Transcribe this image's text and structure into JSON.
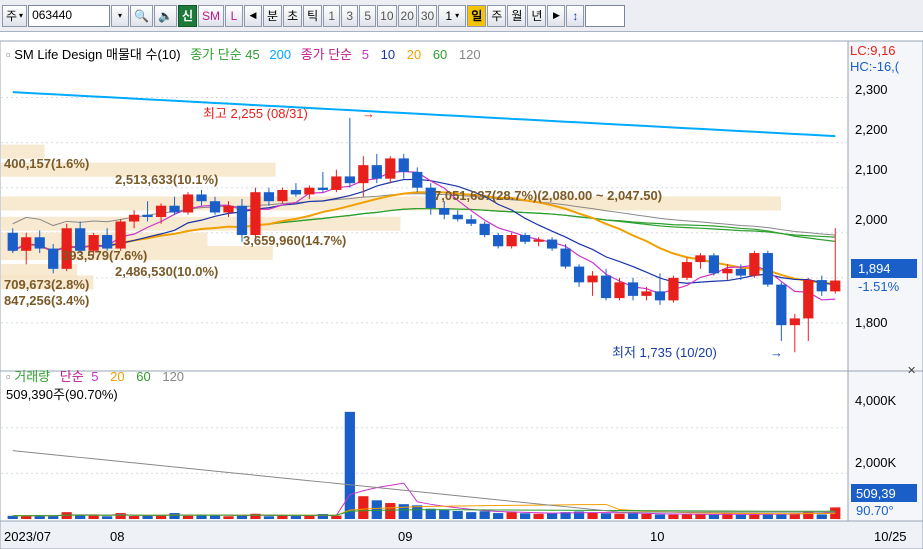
{
  "toolbar": {
    "period": "주",
    "code": "063440",
    "sin": "신",
    "sm": "SM",
    "l": "L",
    "bun": "분",
    "cho": "초",
    "tick": "틱",
    "nums": [
      "1",
      "3",
      "5",
      "10",
      "20",
      "30"
    ],
    "count": "1",
    "day": "일",
    "week": "주",
    "month": "월",
    "year": "년"
  },
  "price_panel": {
    "legend": {
      "title": "SM Life Design 매물대 수(10)",
      "ma_label1": "종가 단순 45",
      "ma_label1_extra": "200",
      "ma_label2": "종가 단순",
      "ma_periods": [
        "5",
        "10",
        "20",
        "60",
        "120"
      ]
    },
    "corner_lc": "LC:9,16",
    "corner_hc": "HC:-16,(",
    "y_ticks": [
      "2,300",
      "2,200",
      "2,100",
      "2,000",
      "1,800"
    ],
    "current_price": "1,894",
    "current_change": "-1.51%",
    "max_label": "최고 2,255 (08/31)",
    "min_label": "최저 1,735 (10/20)",
    "volume_profile": [
      "400,157(1.6%)",
      "2,513,633(10.1%)",
      "7,051,637(28.7%)(2,080.00 ~ 2,047.50)",
      "3,659,960(14.7%)",
      "393,579(7.6%)",
      "2,486,530(10.0%)",
      "709,673(2.8%)",
      "847,256(3.4%)"
    ]
  },
  "volume_panel": {
    "legend": {
      "title": "거래량",
      "ma_label": "단순",
      "periods": [
        "5",
        "20",
        "60",
        "120"
      ]
    },
    "last_vol": "509,390주(90.70%)",
    "y_ticks": [
      "4,000K",
      "2,000K"
    ],
    "current_vol": "509,39",
    "current_pct": "90.70°"
  },
  "x_labels": [
    "2023/07",
    "08",
    "09",
    "10",
    "10/25"
  ],
  "colors": {
    "up": "#e8201c",
    "down": "#1a5fc7",
    "ma5": "#cc33cc",
    "ma10": "#1a33a8",
    "ma20": "#f0a000",
    "ma60": "#2e9e2e",
    "ma120": "#888888",
    "ma45": "#2e9e2e",
    "ma200": "#00aaff"
  },
  "chart_data": {
    "type": "candlestick",
    "x": [
      "07/24",
      "07/25",
      "07/26",
      "07/27",
      "07/28",
      "07/31",
      "08/01",
      "08/02",
      "08/03",
      "08/04",
      "08/07",
      "08/08",
      "08/09",
      "08/10",
      "08/11",
      "08/14",
      "08/16",
      "08/17",
      "08/18",
      "08/21",
      "08/22",
      "08/23",
      "08/24",
      "08/25",
      "08/28",
      "08/29",
      "08/30",
      "08/31",
      "09/01",
      "09/04",
      "09/05",
      "09/06",
      "09/07",
      "09/08",
      "09/11",
      "09/12",
      "09/13",
      "09/14",
      "09/15",
      "09/18",
      "09/19",
      "09/20",
      "09/21",
      "09/22",
      "09/25",
      "09/26",
      "09/27",
      "10/04",
      "10/05",
      "10/06",
      "10/10",
      "10/11",
      "10/12",
      "10/13",
      "10/16",
      "10/17",
      "10/18",
      "10/19",
      "10/20",
      "10/23",
      "10/24",
      "10/25"
    ],
    "ohlc": [
      [
        2000,
        2010,
        1955,
        1960
      ],
      [
        1960,
        2000,
        1930,
        1990
      ],
      [
        1990,
        2005,
        1955,
        1965
      ],
      [
        1965,
        1975,
        1910,
        1920
      ],
      [
        1920,
        2020,
        1915,
        2010
      ],
      [
        2010,
        2025,
        1955,
        1960
      ],
      [
        1960,
        2000,
        1950,
        1995
      ],
      [
        1995,
        2010,
        1960,
        1965
      ],
      [
        1965,
        2030,
        1960,
        2025
      ],
      [
        2025,
        2050,
        2010,
        2040
      ],
      [
        2040,
        2070,
        2025,
        2035
      ],
      [
        2035,
        2065,
        2020,
        2060
      ],
      [
        2060,
        2080,
        2040,
        2045
      ],
      [
        2045,
        2090,
        2040,
        2085
      ],
      [
        2085,
        2095,
        2060,
        2070
      ],
      [
        2070,
        2080,
        2040,
        2045
      ],
      [
        2045,
        2070,
        2035,
        2060
      ],
      [
        2060,
        2075,
        1980,
        1995
      ],
      [
        1995,
        2100,
        1990,
        2090
      ],
      [
        2090,
        2100,
        2060,
        2070
      ],
      [
        2070,
        2100,
        2065,
        2095
      ],
      [
        2095,
        2110,
        2080,
        2085
      ],
      [
        2085,
        2105,
        2075,
        2100
      ],
      [
        2100,
        2135,
        2090,
        2095
      ],
      [
        2095,
        2140,
        2090,
        2125
      ],
      [
        2125,
        2255,
        2100,
        2110
      ],
      [
        2110,
        2170,
        2080,
        2150
      ],
      [
        2150,
        2175,
        2110,
        2120
      ],
      [
        2120,
        2170,
        2110,
        2165
      ],
      [
        2165,
        2175,
        2120,
        2135
      ],
      [
        2135,
        2145,
        2090,
        2100
      ],
      [
        2100,
        2110,
        2040,
        2055
      ],
      [
        2055,
        2070,
        2030,
        2040
      ],
      [
        2040,
        2050,
        2025,
        2030
      ],
      [
        2030,
        2040,
        2015,
        2020
      ],
      [
        2020,
        2025,
        1990,
        1995
      ],
      [
        1995,
        2000,
        1965,
        1970
      ],
      [
        1970,
        2000,
        1965,
        1995
      ],
      [
        1995,
        2000,
        1975,
        1980
      ],
      [
        1980,
        1990,
        1970,
        1985
      ],
      [
        1985,
        1990,
        1960,
        1965
      ],
      [
        1965,
        1975,
        1920,
        1925
      ],
      [
        1925,
        1930,
        1880,
        1890
      ],
      [
        1890,
        1915,
        1860,
        1905
      ],
      [
        1905,
        1920,
        1850,
        1855
      ],
      [
        1855,
        1900,
        1850,
        1890
      ],
      [
        1890,
        1900,
        1850,
        1860
      ],
      [
        1860,
        1880,
        1850,
        1870
      ],
      [
        1870,
        1910,
        1840,
        1850
      ],
      [
        1850,
        1905,
        1845,
        1900
      ],
      [
        1900,
        1945,
        1895,
        1935
      ],
      [
        1935,
        1955,
        1920,
        1950
      ],
      [
        1950,
        1955,
        1905,
        1910
      ],
      [
        1910,
        1930,
        1895,
        1920
      ],
      [
        1920,
        1930,
        1895,
        1905
      ],
      [
        1905,
        1960,
        1900,
        1955
      ],
      [
        1955,
        1960,
        1880,
        1885
      ],
      [
        1885,
        1890,
        1760,
        1795
      ],
      [
        1795,
        1820,
        1735,
        1810
      ],
      [
        1810,
        1900,
        1760,
        1895
      ],
      [
        1895,
        1905,
        1860,
        1870
      ],
      [
        1870,
        2010,
        1865,
        1894
      ]
    ],
    "volume": [
      140,
      145,
      160,
      130,
      300,
      160,
      150,
      120,
      260,
      130,
      140,
      150,
      260,
      140,
      190,
      150,
      120,
      150,
      230,
      120,
      150,
      130,
      130,
      220,
      150,
      4700,
      1000,
      820,
      700,
      650,
      600,
      450,
      400,
      350,
      300,
      340,
      260,
      300,
      250,
      230,
      260,
      300,
      330,
      270,
      250,
      230,
      250,
      220,
      200,
      190,
      220,
      210,
      190,
      240,
      190,
      190,
      230,
      210,
      250,
      350,
      200,
      509
    ],
    "ylim": [
      1700,
      2350
    ],
    "vol_ylim": [
      0,
      5000
    ]
  }
}
